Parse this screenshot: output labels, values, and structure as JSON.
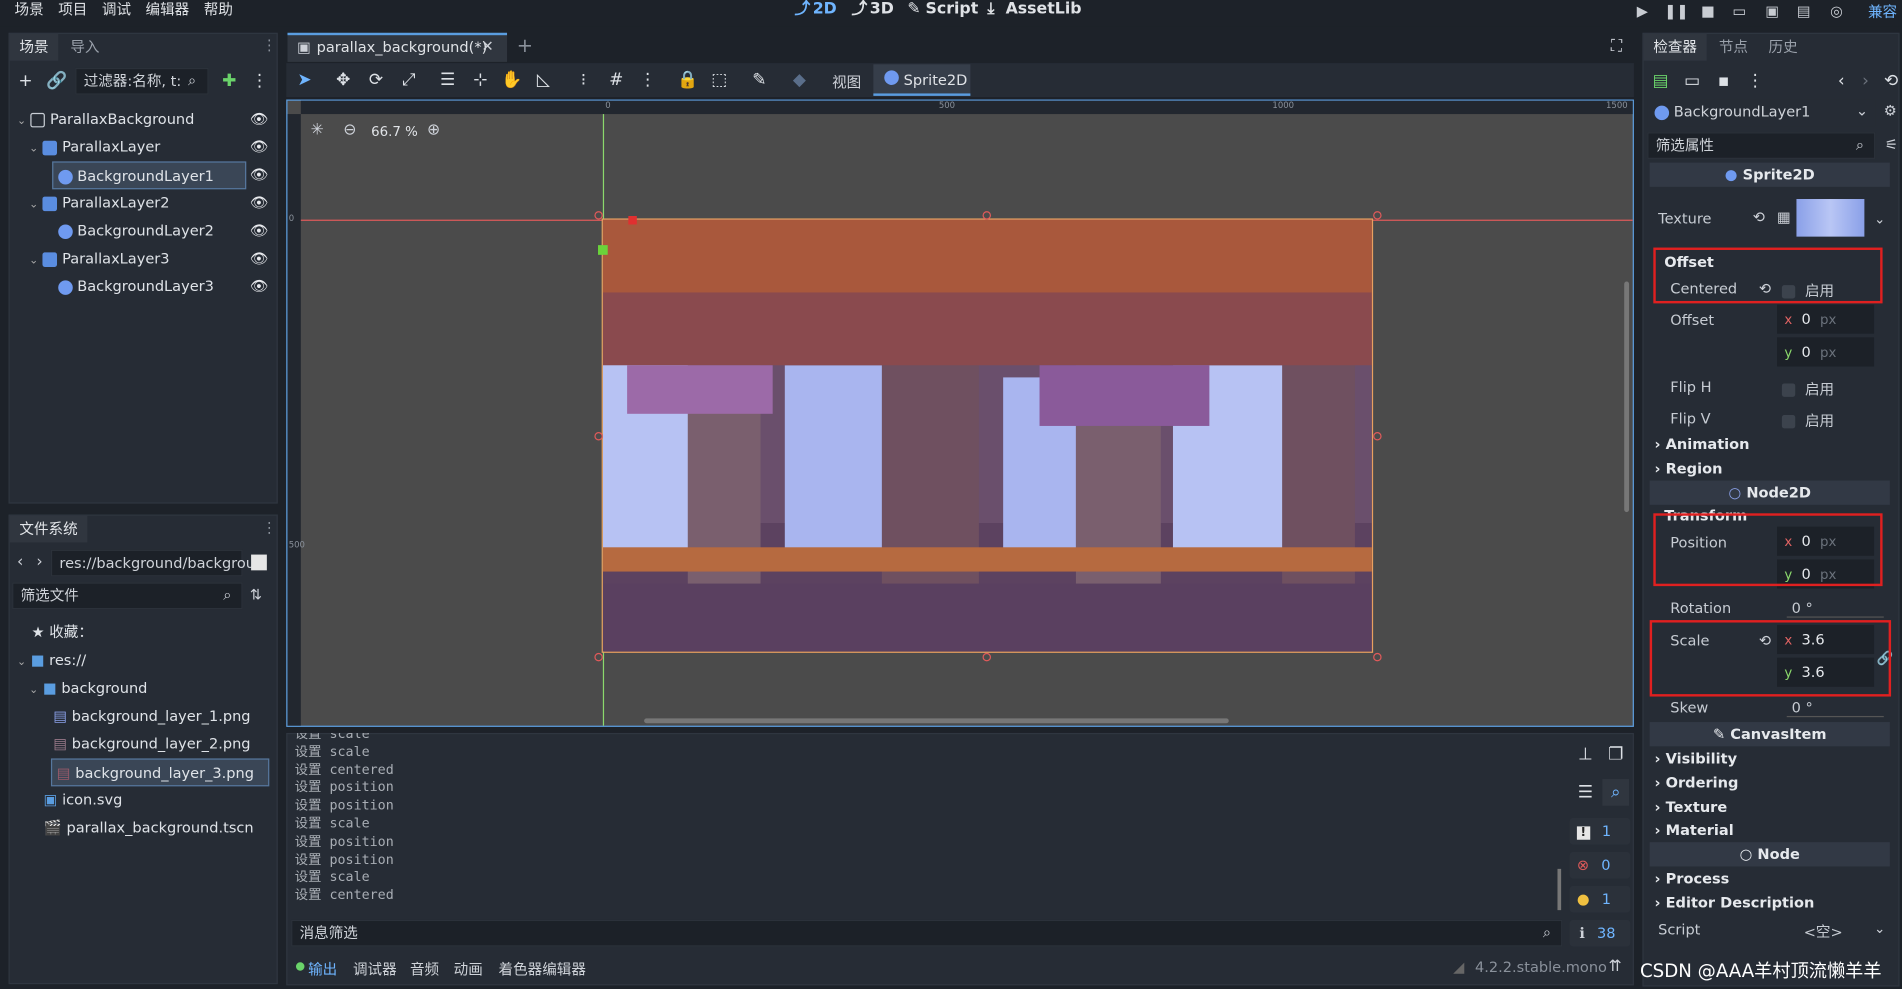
{
  "menu": [
    "场景",
    "项目",
    "调试",
    "编辑器",
    "帮助"
  ],
  "main_tabs": [
    "2D",
    "3D",
    "Script",
    "AssetLib"
  ],
  "compat": "兼容",
  "scene_dock": {
    "tabs": [
      "场景",
      "导入"
    ],
    "filter_placeholder": "过滤器:名称, t:",
    "tree": [
      {
        "label": "ParallaxBackground"
      },
      {
        "label": "ParallaxLayer"
      },
      {
        "label": "BackgroundLayer1"
      },
      {
        "label": "ParallaxLayer2"
      },
      {
        "label": "BackgroundLayer2"
      },
      {
        "label": "ParallaxLayer3"
      },
      {
        "label": "BackgroundLayer3"
      }
    ]
  },
  "fs_dock": {
    "title": "文件系统",
    "path": "res://background/backgrou",
    "filter_placeholder": "筛选文件",
    "items": [
      "收藏：",
      "res://",
      "background",
      "background_layer_1.png",
      "background_layer_2.png",
      "background_layer_3.png",
      "icon.svg",
      "parallax_background.tscn"
    ]
  },
  "editor_tab": {
    "label": "parallax_background(*)",
    "close": "✕",
    "add": "+"
  },
  "toolbar": {
    "view": "视图",
    "sprite": "Sprite2D"
  },
  "zoom": "66.7 %",
  "rulers": {
    "h": [
      "0",
      "500",
      "1000",
      "1500"
    ],
    "v": [
      "0",
      "500"
    ]
  },
  "output": {
    "lines": [
      "设置 scale",
      "设置 scale",
      "设置 centered",
      "设置 position",
      "设置 position",
      "设置 scale",
      "设置 position",
      "设置 position",
      "设置 scale",
      "设置 centered"
    ],
    "filter_placeholder": "消息筛选",
    "counters": [
      "1",
      "0",
      "1",
      "38"
    ]
  },
  "bottom_tabs": [
    "输出",
    "调试器",
    "音频",
    "动画",
    "着色器编辑器"
  ],
  "version": "4.2.2.stable.mono",
  "inspector": {
    "tabs": [
      "检查器",
      "节点",
      "历史"
    ],
    "node": "BackgroundLayer1",
    "filter_placeholder": "筛选属性",
    "sprite_cat": "Sprite2D",
    "texture_label": "Texture",
    "offset_section": "Offset",
    "centered": "Centered",
    "enable": "启用",
    "offset_label": "Offset",
    "offset_x": "0",
    "offset_y": "0",
    "px": "px",
    "flip_h": "Flip H",
    "flip_v": "Flip V",
    "animation": "Animation",
    "region": "Region",
    "node2d_cat": "Node2D",
    "transform": "Transform",
    "position": "Position",
    "pos_x": "0",
    "pos_y": "0",
    "rotation": "Rotation",
    "rotation_val": "0 °",
    "scale": "Scale",
    "scale_x": "3.6",
    "scale_y": "3.6",
    "skew": "Skew",
    "skew_val": "0 °",
    "canvas_cat": "CanvasItem",
    "visibility": "Visibility",
    "ordering": "Ordering",
    "texture": "Texture",
    "material": "Material",
    "node_cat": "Node",
    "process": "Process",
    "editor_desc": "Editor Description",
    "script": "Script",
    "script_val": "<空>"
  },
  "watermark": "CSDN @AAA羊村顶流懒羊羊",
  "colors": {
    "accent": "#6fb5ff",
    "selection_frame": "#e8a060",
    "y_axis": "#8bd96c",
    "x_axis": "#e05a5a",
    "highlight": "#e02020"
  }
}
